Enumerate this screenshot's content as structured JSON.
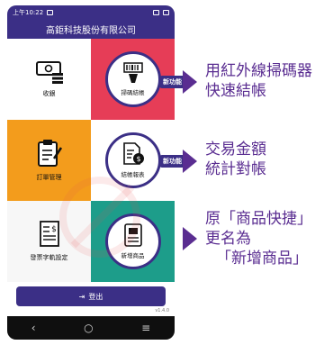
{
  "status_bar": {
    "time": "上午10:22"
  },
  "app": {
    "title": "高鉅科技股份有限公司"
  },
  "tiles": [
    {
      "label": "收銀"
    },
    {
      "label": "掃碼結帳"
    },
    {
      "label": "訂單管理"
    },
    {
      "label": "結帳報表"
    },
    {
      "label": "發票字軌設定"
    },
    {
      "label": "新增商品"
    }
  ],
  "badges": {
    "new_feature": "新功能"
  },
  "annotations": {
    "scan": [
      "用紅外線掃碼器",
      "快速結帳"
    ],
    "report": [
      "交易金額",
      "統計對帳"
    ],
    "rename": [
      "原「商品快捷」",
      "更名為",
      "「新增商品」"
    ]
  },
  "logout": {
    "label": "登出"
  },
  "version": "v1.4.0",
  "nav": {
    "back": "‹",
    "home": "○",
    "menu": "≡"
  },
  "colors": {
    "primary": "#3b2f86",
    "red": "#e63d57",
    "orange": "#f39c1c",
    "teal": "#1d9d8a",
    "annotation": "#5a2d91"
  }
}
